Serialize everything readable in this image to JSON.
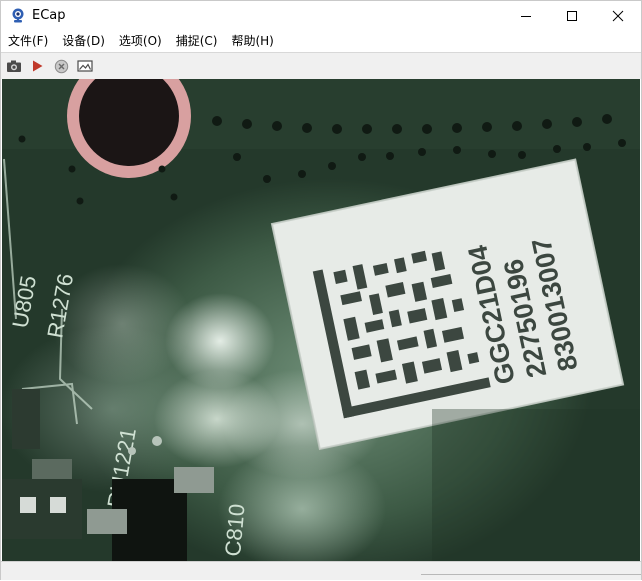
{
  "window": {
    "title": "ECap",
    "controls": {
      "minimize": "minimize-icon",
      "maximize": "maximize-icon",
      "close": "close-icon"
    }
  },
  "menu": {
    "items": [
      {
        "label": "文件(F)"
      },
      {
        "label": "设备(D)"
      },
      {
        "label": "选项(O)"
      },
      {
        "label": "捕捉(C)"
      },
      {
        "label": "帮助(H)"
      }
    ]
  },
  "toolbar": {
    "buttons": [
      {
        "icon": "camera-icon"
      },
      {
        "icon": "play-icon",
        "color": "#c0392b"
      },
      {
        "icon": "stop-icon"
      },
      {
        "icon": "picture-icon"
      }
    ]
  },
  "video": {
    "label_lines": [
      "GGC21D04",
      "22750196",
      "830013007"
    ],
    "silkscreen": [
      "U805",
      "R1276",
      "RU1221",
      "C810"
    ]
  }
}
